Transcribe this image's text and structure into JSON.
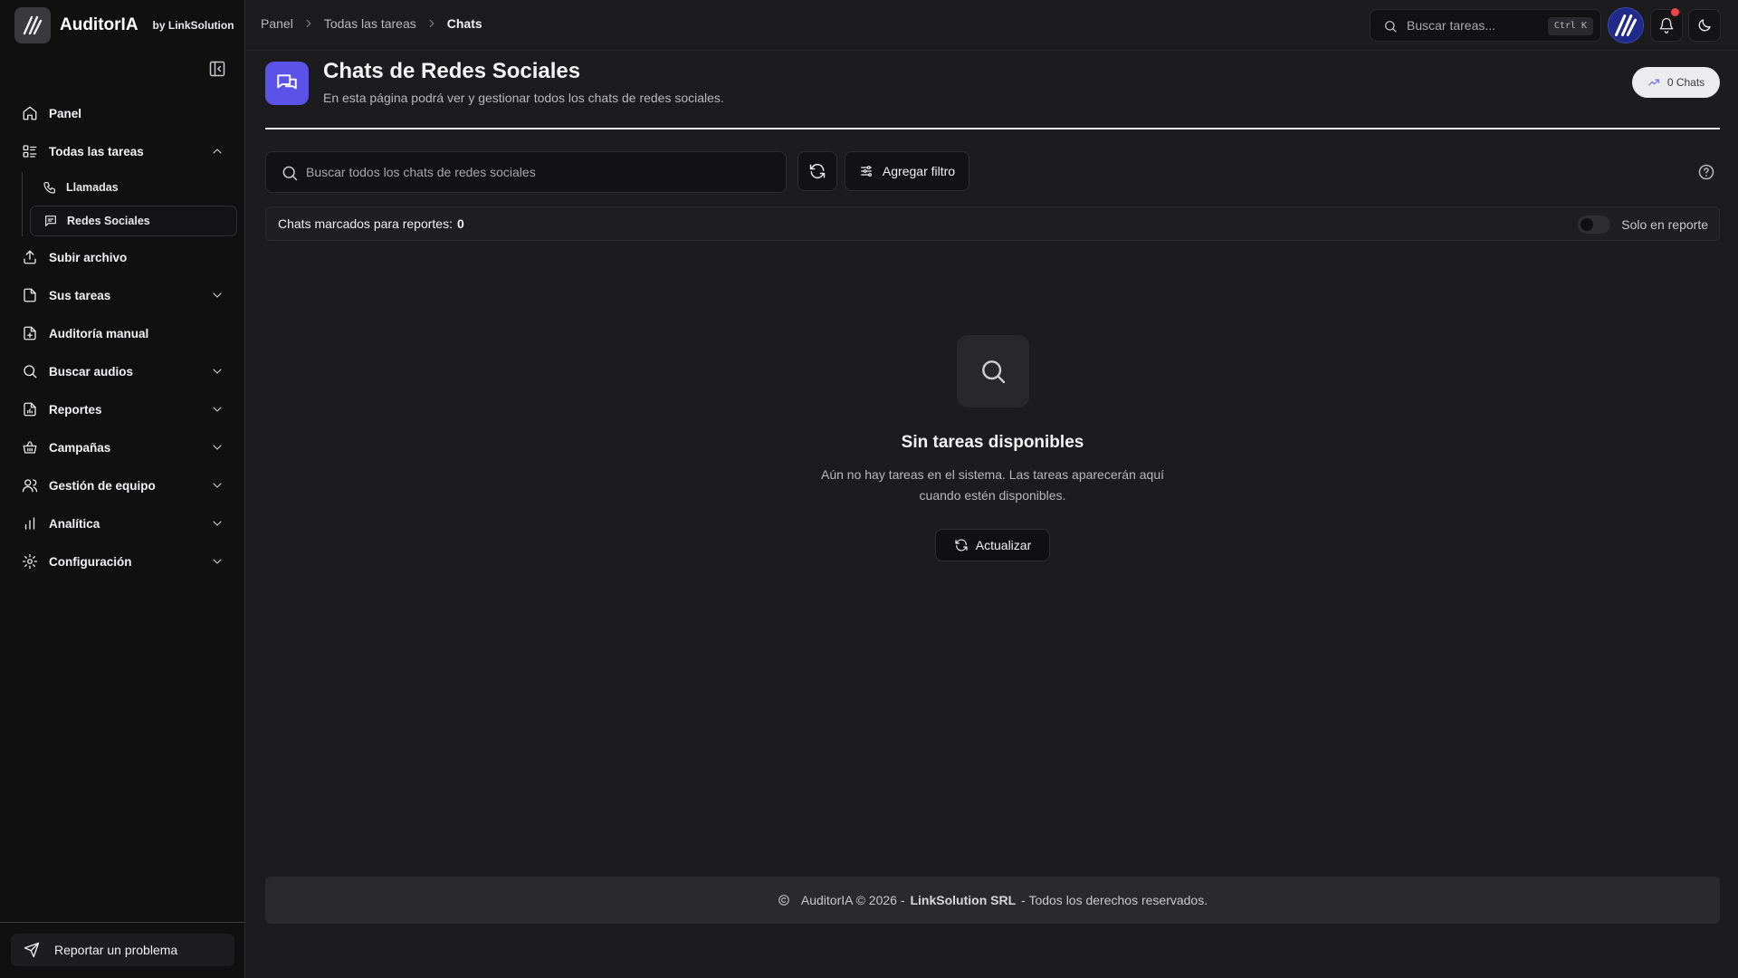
{
  "brand": {
    "name": "AuditorIA",
    "by": "by LinkSolution"
  },
  "sidebar": {
    "items": [
      {
        "label": "Panel",
        "icon": "home-icon"
      },
      {
        "label": "Todas las tareas",
        "icon": "list-icon",
        "expanded": true,
        "children": [
          {
            "label": "Llamadas",
            "icon": "phone-icon"
          },
          {
            "label": "Redes Sociales",
            "icon": "message-icon",
            "active": true
          }
        ]
      },
      {
        "label": "Subir archivo",
        "icon": "upload-icon"
      },
      {
        "label": "Sus tareas",
        "icon": "file-icon"
      },
      {
        "label": "Auditoría manual",
        "icon": "file-plus-icon"
      },
      {
        "label": "Buscar audios",
        "icon": "search-icon"
      },
      {
        "label": "Reportes",
        "icon": "report-icon"
      },
      {
        "label": "Campañas",
        "icon": "shopping-basket-icon"
      },
      {
        "label": "Gestión de equipo",
        "icon": "users-icon"
      },
      {
        "label": "Analítica",
        "icon": "bar-chart-icon"
      },
      {
        "label": "Configuración",
        "icon": "gear-icon"
      }
    ],
    "report_problem": "Reportar un problema"
  },
  "topbar": {
    "breadcrumb": [
      "Panel",
      "Todas las tareas",
      "Chats"
    ],
    "search_placeholder": "Buscar tareas...",
    "shortcut": "Ctrl K"
  },
  "page": {
    "title": "Chats de Redes Sociales",
    "subtitle": "En esta página podrá ver y gestionar todos los chats de redes sociales.",
    "chats_badge": "0 Chats"
  },
  "toolbar": {
    "search_placeholder": "Buscar todos los chats de redes sociales",
    "filter_label": "Agregar filtro"
  },
  "report_bar": {
    "label": "Chats marcados para reportes:",
    "count": "0",
    "toggle_label": "Solo en reporte"
  },
  "empty_state": {
    "title": "Sin tareas disponibles",
    "description": "Aún no hay tareas en el sistema. Las tareas aparecerán aquí cuando estén disponibles.",
    "button": "Actualizar"
  },
  "footer": {
    "prefix": "AuditorIA © 2026 -",
    "company": "LinkSolution SRL",
    "suffix": "- Todos los derechos reservados."
  },
  "colors": {
    "accent": "#5b52e8",
    "background": "#1c1c1e",
    "sidebar": "#101011",
    "notification": "#ef4444"
  }
}
